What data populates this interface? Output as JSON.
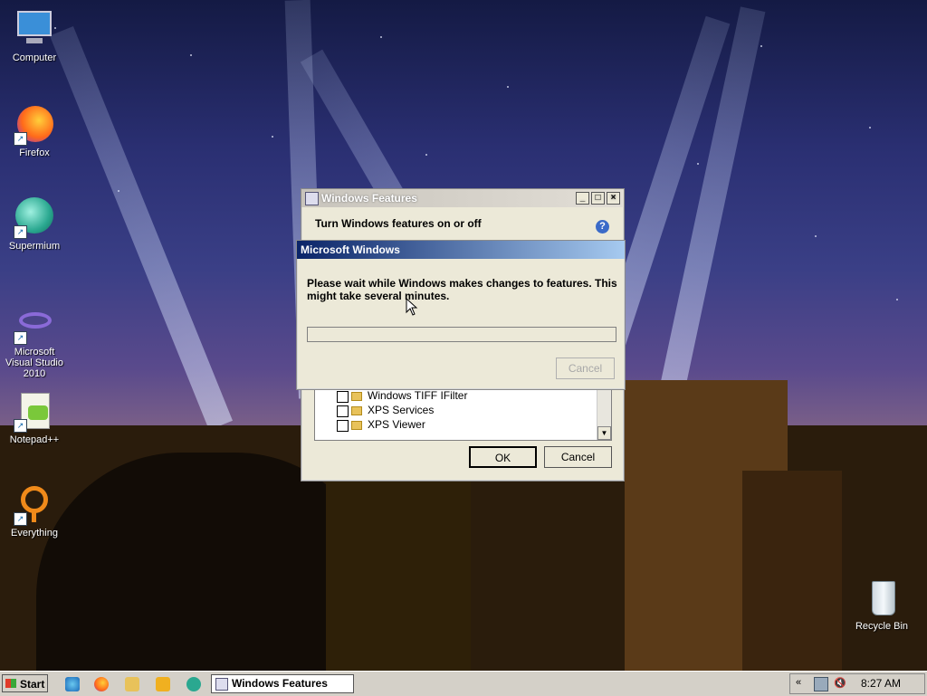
{
  "desktop": {
    "icons": [
      {
        "label": "Computer"
      },
      {
        "label": "Firefox"
      },
      {
        "label": "Supermium"
      },
      {
        "label": "Microsoft Visual Studio 2010"
      },
      {
        "label": "Notepad++"
      },
      {
        "label": "Everything"
      },
      {
        "label": "Recycle Bin"
      }
    ]
  },
  "features_window": {
    "title": "Windows Features",
    "heading": "Turn Windows features on or off",
    "help_icon": "help-icon",
    "items": [
      {
        "label": "Windows TIFF IFilter",
        "checked": false
      },
      {
        "label": "XPS Services",
        "checked": false
      },
      {
        "label": "XPS Viewer",
        "checked": false
      }
    ],
    "ok_label": "OK",
    "cancel_label": "Cancel"
  },
  "progress_dialog": {
    "title": "Microsoft Windows",
    "message": "Please wait while Windows makes changes to features. This might take several minutes.",
    "progress": 0,
    "cancel_label": "Cancel"
  },
  "taskbar": {
    "start_label": "Start",
    "quick_launch": [
      "internet-explorer-icon",
      "firefox-icon",
      "folder-icon",
      "media-player-icon",
      "supermium-icon"
    ],
    "active_task": "Windows Features",
    "clock": "8:27 AM",
    "tray_icons": [
      "show-hidden-icon",
      "network-icon",
      "volume-muted-icon"
    ]
  }
}
